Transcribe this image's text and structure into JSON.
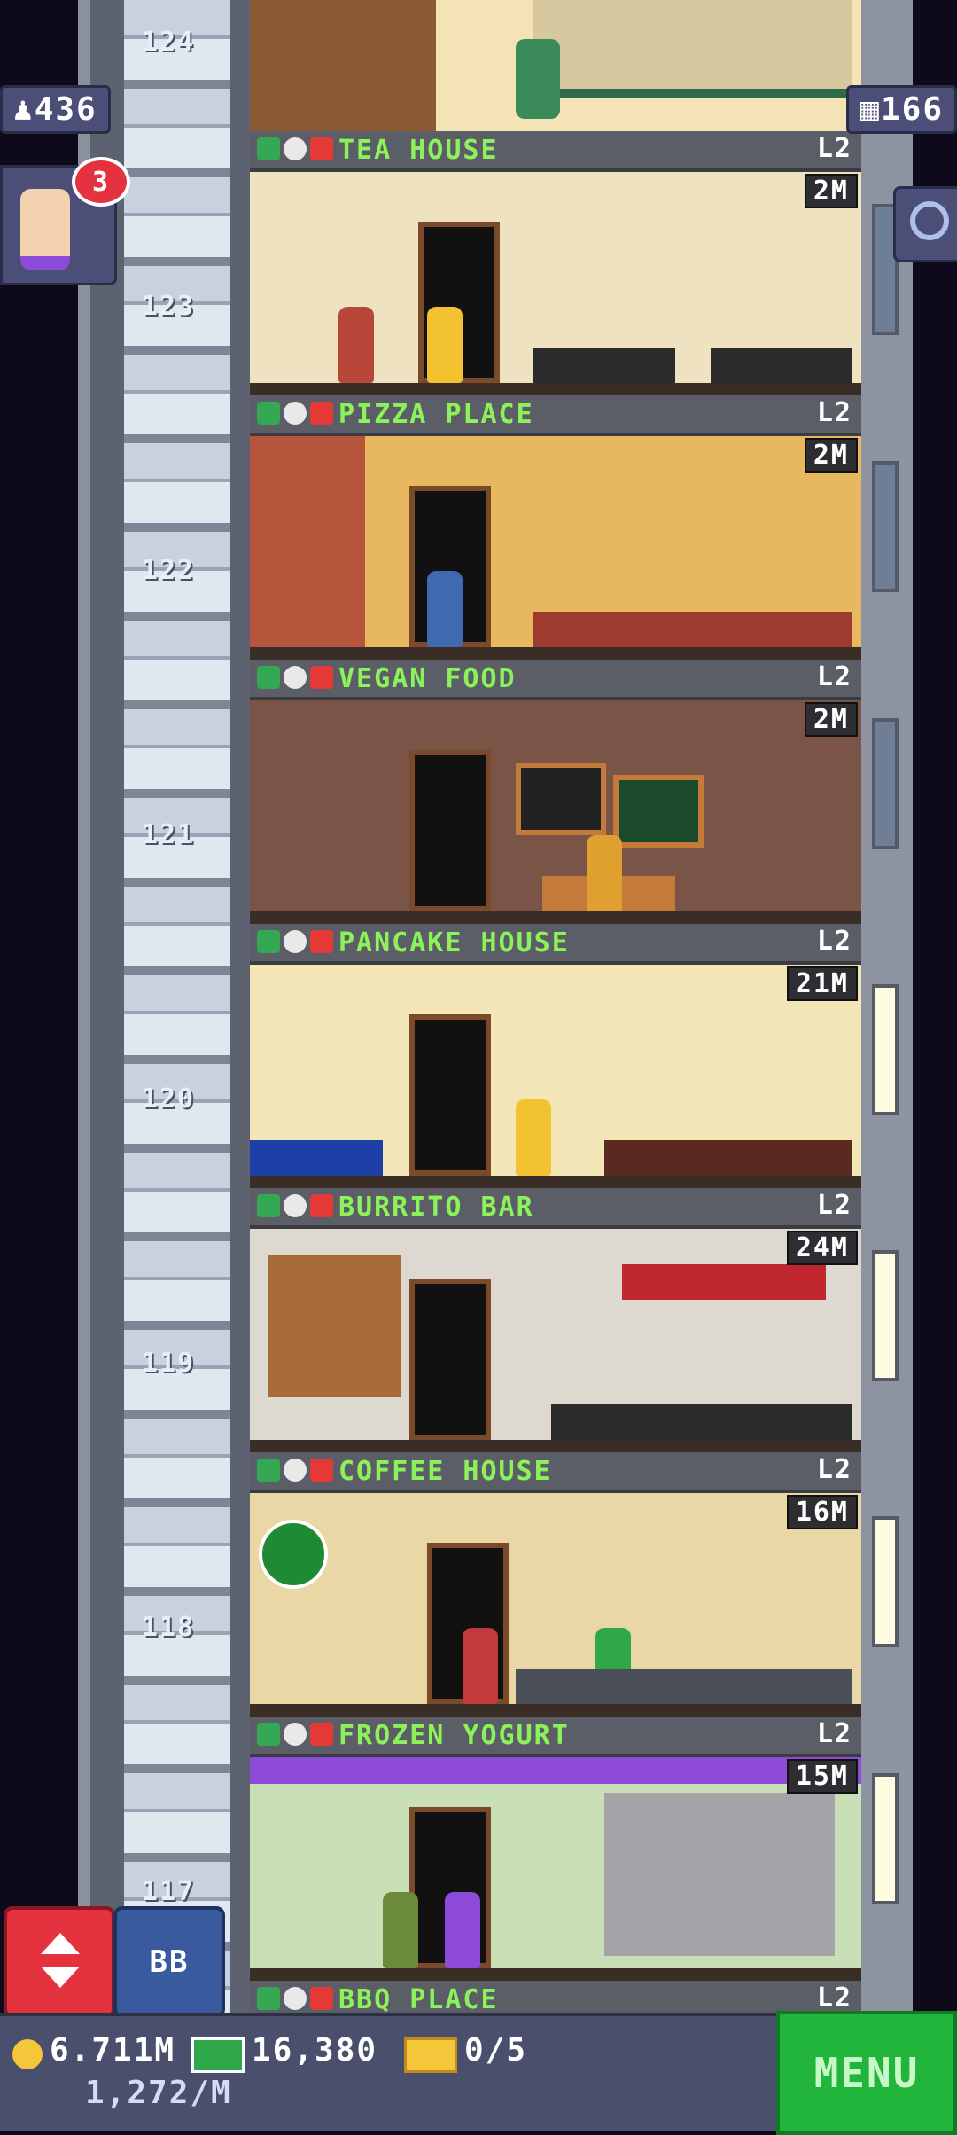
{
  "hud": {
    "population": "436",
    "floors_count": "166",
    "notification_count": "3"
  },
  "floor_numbers": [
    "124",
    "123",
    "122",
    "121",
    "120",
    "119",
    "118",
    "117"
  ],
  "floors": [
    {
      "name": "TEA HOUSE",
      "level": "L2",
      "income": "2M",
      "bg": "#efe2c0"
    },
    {
      "name": "PIZZA PLACE",
      "level": "L2",
      "income": "2M",
      "bg": "#e8b860"
    },
    {
      "name": "VEGAN FOOD",
      "level": "L2",
      "income": "2M",
      "bg": "#7a5446"
    },
    {
      "name": "PANCAKE HOUSE",
      "level": "L2",
      "income": "21M",
      "bg": "#f3e6b6"
    },
    {
      "name": "BURRITO BAR",
      "level": "L2",
      "income": "24M",
      "bg": "#ddd8d0"
    },
    {
      "name": "COFFEE HOUSE",
      "level": "L2",
      "income": "16M",
      "bg": "#ead7a6"
    },
    {
      "name": "FROZEN YOGURT",
      "level": "L2",
      "income": "15M",
      "bg": "#c9e0b6"
    },
    {
      "name": "BBQ PLACE",
      "level": "L2"
    }
  ],
  "buttons": {
    "bb_label": "BB",
    "menu_label": "MENU"
  },
  "status": {
    "coins": "6.711M",
    "cash": "16,380",
    "tickets": "0/5",
    "rate": "1,272/M"
  },
  "colors": {
    "floor_name": "#8cf25a",
    "menu": "#21b53b",
    "elevator_button": "#e5323f"
  }
}
